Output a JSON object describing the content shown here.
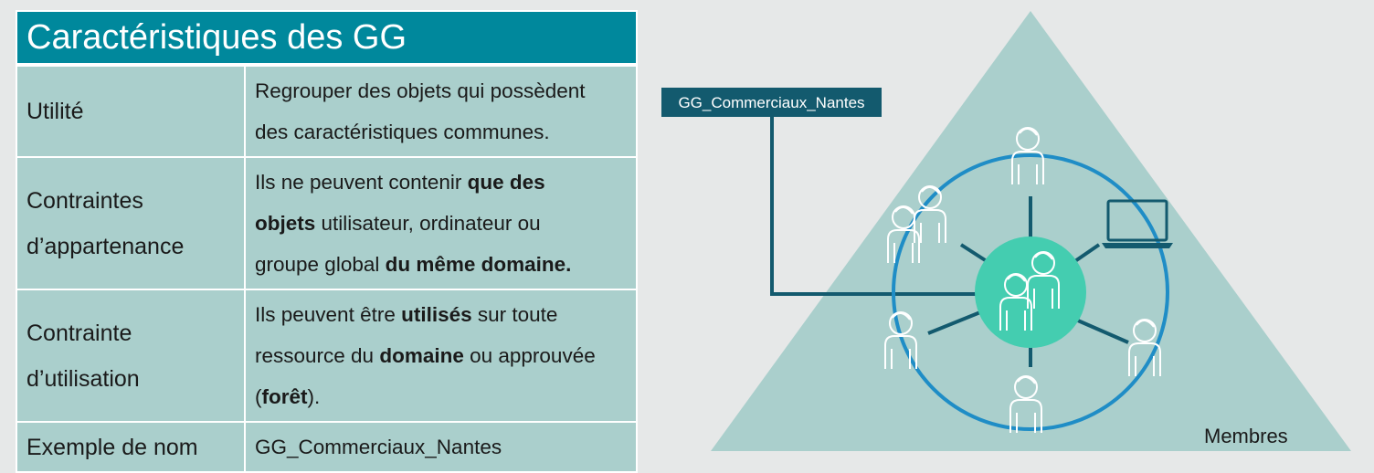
{
  "table": {
    "title": "Caractéristiques des GG",
    "rows": [
      {
        "label_lines": [
          "Utilité"
        ],
        "value_lines": [
          [
            {
              "t": "Regrouper des objets qui possèdent",
              "b": false
            }
          ],
          [
            {
              "t": "des caractéristiques communes.",
              "b": false
            }
          ]
        ]
      },
      {
        "label_lines": [
          "Contraintes",
          "d’appartenance"
        ],
        "value_lines": [
          [
            {
              "t": "Ils ne peuvent contenir ",
              "b": false
            },
            {
              "t": "que des",
              "b": true
            }
          ],
          [
            {
              "t": "objets",
              "b": true
            },
            {
              "t": " utilisateur, ordinateur ou",
              "b": false
            }
          ],
          [
            {
              "t": "groupe global ",
              "b": false
            },
            {
              "t": "du même domaine.",
              "b": true
            }
          ]
        ]
      },
      {
        "label_lines": [
          "Contrainte",
          "d’utilisation"
        ],
        "value_lines": [
          [
            {
              "t": "Ils peuvent être ",
              "b": false
            },
            {
              "t": "utilisés",
              "b": true
            },
            {
              "t": " sur toute",
              "b": false
            }
          ],
          [
            {
              "t": "ressource du ",
              "b": false
            },
            {
              "t": "domaine",
              "b": true
            },
            {
              "t": " ou approuvée",
              "b": false
            }
          ],
          [
            {
              "t": "(",
              "b": false
            },
            {
              "t": "forêt",
              "b": true
            },
            {
              "t": ").",
              "b": false
            }
          ]
        ]
      },
      {
        "label_lines": [
          "Exemple de nom"
        ],
        "value_lines": [
          [
            {
              "t": "GG_Commerciaux_Nantes",
              "b": false
            }
          ]
        ]
      }
    ]
  },
  "diagram": {
    "group_label": "GG_Commerciaux_Nantes",
    "members_label": "Membres",
    "colors": {
      "triangle": "#aacfcc",
      "ring": "#1f8dc6",
      "center": "#44cdb0",
      "label_bg": "#135a6e",
      "connector": "#135a6e"
    }
  }
}
